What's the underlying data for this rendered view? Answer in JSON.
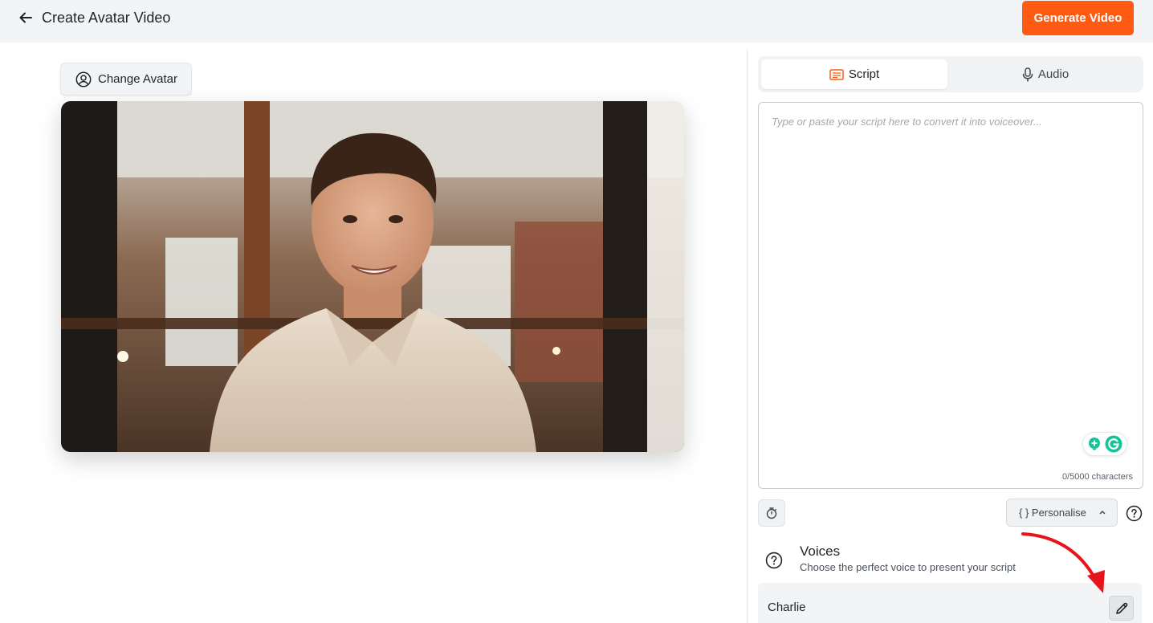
{
  "header": {
    "title": "Create Avatar Video",
    "generate_label": "Generate Video"
  },
  "avatar": {
    "change_label": "Change Avatar"
  },
  "tabs": [
    {
      "label": "Script",
      "icon": "subtitles-icon",
      "active": true
    },
    {
      "label": "Audio",
      "icon": "microphone-icon",
      "active": false
    }
  ],
  "script": {
    "value": "",
    "placeholder": "Type or paste your script here to convert it into voiceover...",
    "char_count": "0/5000 characters"
  },
  "toolbar": {
    "personalise_label": "{ } Personalise"
  },
  "voices": {
    "title": "Voices",
    "subtitle": "Choose the perfect voice to present your script",
    "selected": "Charlie"
  },
  "colors": {
    "accent": "#ff5a12",
    "annotation_arrow": "#e8141b"
  }
}
